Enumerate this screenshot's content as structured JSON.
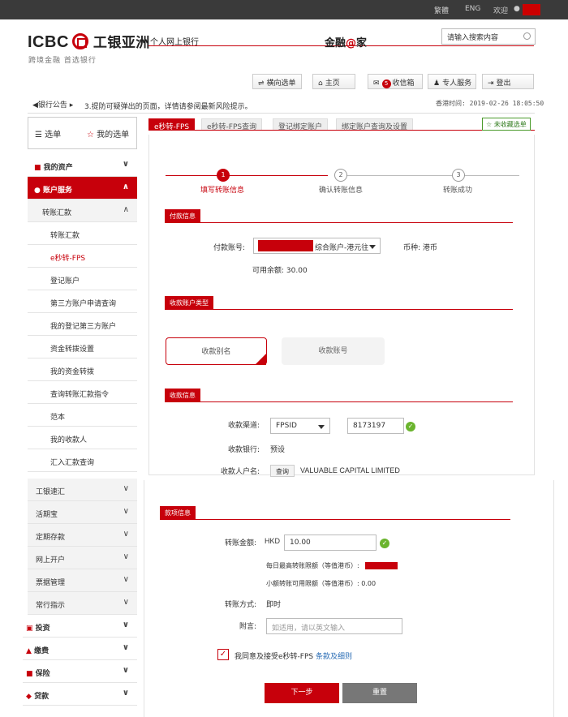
{
  "topbar": {
    "traditional": "繁體",
    "english": "ENG",
    "welcome": "欢迎"
  },
  "header": {
    "logo_text": "ICBC",
    "logo_cn": "工银亚洲",
    "tagline": "跨境金融 首选银行",
    "personal_banking": "个人网上银行",
    "slogan_prefix": "金融",
    "slogan_at": "@",
    "slogan_suffix": "家",
    "search_placeholder": "请输入搜索内容"
  },
  "actions": {
    "nav_menu": "横向选单",
    "home": "主页",
    "inbox_count": "5",
    "inbox": "收信箱",
    "personal_service": "专人服务",
    "logout": "登出"
  },
  "announce": {
    "label": "银行公告",
    "text": "3.提防可疑弹出的页面，详情请参阅最新风险提示。",
    "time_label": "香港时间:",
    "time": "2019-02-26 18:05:50"
  },
  "sidebar": {
    "tab_menu": "选单",
    "tab_my_menu": "我的选单",
    "my_assets": "我的资产",
    "account_services": "账户服务",
    "transfer_remit": "转账汇款",
    "items": [
      "转账汇款",
      "e秒转-FPS",
      "登记账户",
      "第三方账户申请查询",
      "我的登记第三方账户",
      "资金转拨设置",
      "我的资金转拨",
      "查询转账汇款指令",
      "范本",
      "我的收款人",
      "汇入汇款查询"
    ],
    "lower_items": [
      "工银速汇",
      "活期宝",
      "定期存款",
      "网上开户",
      "票据管理",
      "常行指示"
    ],
    "investment": "投资",
    "payment": "缴费",
    "insurance": "保险",
    "loans": "贷款"
  },
  "tabs": [
    "e秒转-FPS",
    "e秒转-FPS查询",
    "登记绑定账户",
    "绑定账户查询及设置"
  ],
  "favorite": "未收藏选单",
  "steps": [
    {
      "num": "1",
      "label": "填写转账信息"
    },
    {
      "num": "2",
      "label": "确认转账信息"
    },
    {
      "num": "3",
      "label": "转账成功"
    }
  ],
  "payment": {
    "header": "付款信息",
    "account_label": "付款账号:",
    "account_suffix": "综合账户-港元往",
    "currency_label": "币种:",
    "currency": "港币",
    "balance_label": "可用余额:",
    "balance": "30.00"
  },
  "payee_type": {
    "header": "收款账户类型",
    "alias": "收款别名",
    "account_no": "收款账号"
  },
  "payee": {
    "header": "收款信息",
    "channel_label": "收款渠道:",
    "channel": "FPSID",
    "fps_id": "8173197",
    "bank_label": "收款银行:",
    "bank": "预设",
    "name_label": "收款人户名:",
    "query": "查询",
    "name": "VALUABLE CAPITAL LIMITED"
  },
  "amount": {
    "header": "款项信息",
    "amount_label": "转账金额:",
    "currency": "HKD",
    "value": "10.00",
    "daily_limit": "每日最高转账限额（等值港币）:",
    "small_limit": "小额转账可用限额（等值港币）:",
    "small_limit_value": "0.00",
    "method_label": "转账方式:",
    "method": "即时",
    "remark_label": "附言:",
    "remark_placeholder": "如适用，请以英文输入",
    "agree_text": "我同意及接受e秒转-FPS",
    "terms_link": "条款及细则",
    "next": "下一步",
    "reset": "重置"
  }
}
